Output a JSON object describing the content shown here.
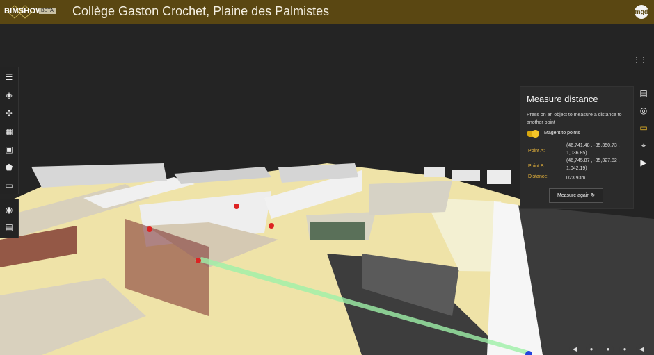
{
  "app": {
    "name": "BIMSHOW",
    "badge": "BETA",
    "title": "Collège Gaston Crochet, Plaine des Palmistes",
    "user": "mgd"
  },
  "left_toolbar": [
    "list-icon",
    "layers-icon",
    "components-icon",
    "calendar-icon",
    "photo-icon",
    "tag-icon",
    "paint-roller-icon",
    "camera-icon",
    "gallery-icon"
  ],
  "right_toolbar": [
    "document-icon",
    "eye-icon",
    "ruler-icon",
    "pin-icon",
    "play-icon"
  ],
  "measure": {
    "title": "Measure distance",
    "description": "Press on an object to measure a distance to another point",
    "toggle_label": "Magent to points",
    "point_a_label": "Point A:",
    "point_a_value": "(46,741.48 , -35,350.73 , 1,036.85)",
    "point_b_label": "Point B:",
    "point_b_value": "(46,745.87 , -35,327.82 , 1,042.19)",
    "distance_label": "Distance:",
    "distance_value": "023.93m",
    "button": "Measure again"
  }
}
